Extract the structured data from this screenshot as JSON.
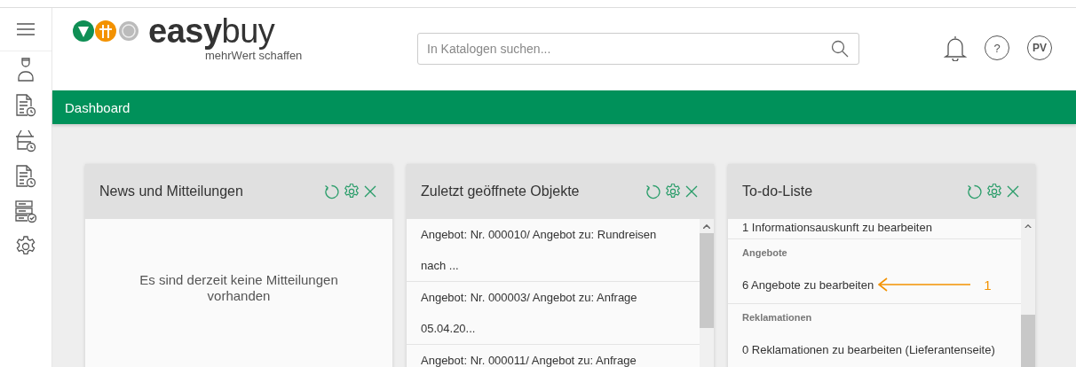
{
  "logo": {
    "brand_bold": "easy",
    "brand_light": "buy",
    "tagline": "mehrWert schaffen"
  },
  "search": {
    "placeholder": "In Katalogen suchen..."
  },
  "help_label": "?",
  "user": {
    "initials": "PV"
  },
  "title_bar": "Dashboard",
  "cards": [
    {
      "kind": "message",
      "title": "News und Mitteilungen",
      "message": "Es sind derzeit keine Mitteilungen vorhanden"
    },
    {
      "kind": "list",
      "title": "Zuletzt geöffnete Objekte",
      "items": [
        {
          "lines": [
            "Angebot: Nr. 000010/ Angebot zu: Rundreisen",
            "nach ..."
          ]
        },
        {
          "lines": [
            "Angebot: Nr. 000003/ Angebot zu: Anfrage",
            "05.04.20..."
          ]
        },
        {
          "lines": [
            "Angebot: Nr. 000011/ Angebot zu: Anfrage"
          ]
        }
      ]
    },
    {
      "kind": "todo",
      "title": "To-do-Liste",
      "cut_line": "1 Informationsauskunft zu bearbeiten",
      "sections": [
        {
          "heading": "Angebote",
          "items": [
            {
              "text": "6 Angebote zu bearbeiten",
              "annotation": "1"
            }
          ]
        },
        {
          "heading": "Reklamationen",
          "items": [
            {
              "text": "0 Reklamationen zu bearbeiten (Lieferantenseite)"
            }
          ]
        }
      ]
    }
  ]
}
